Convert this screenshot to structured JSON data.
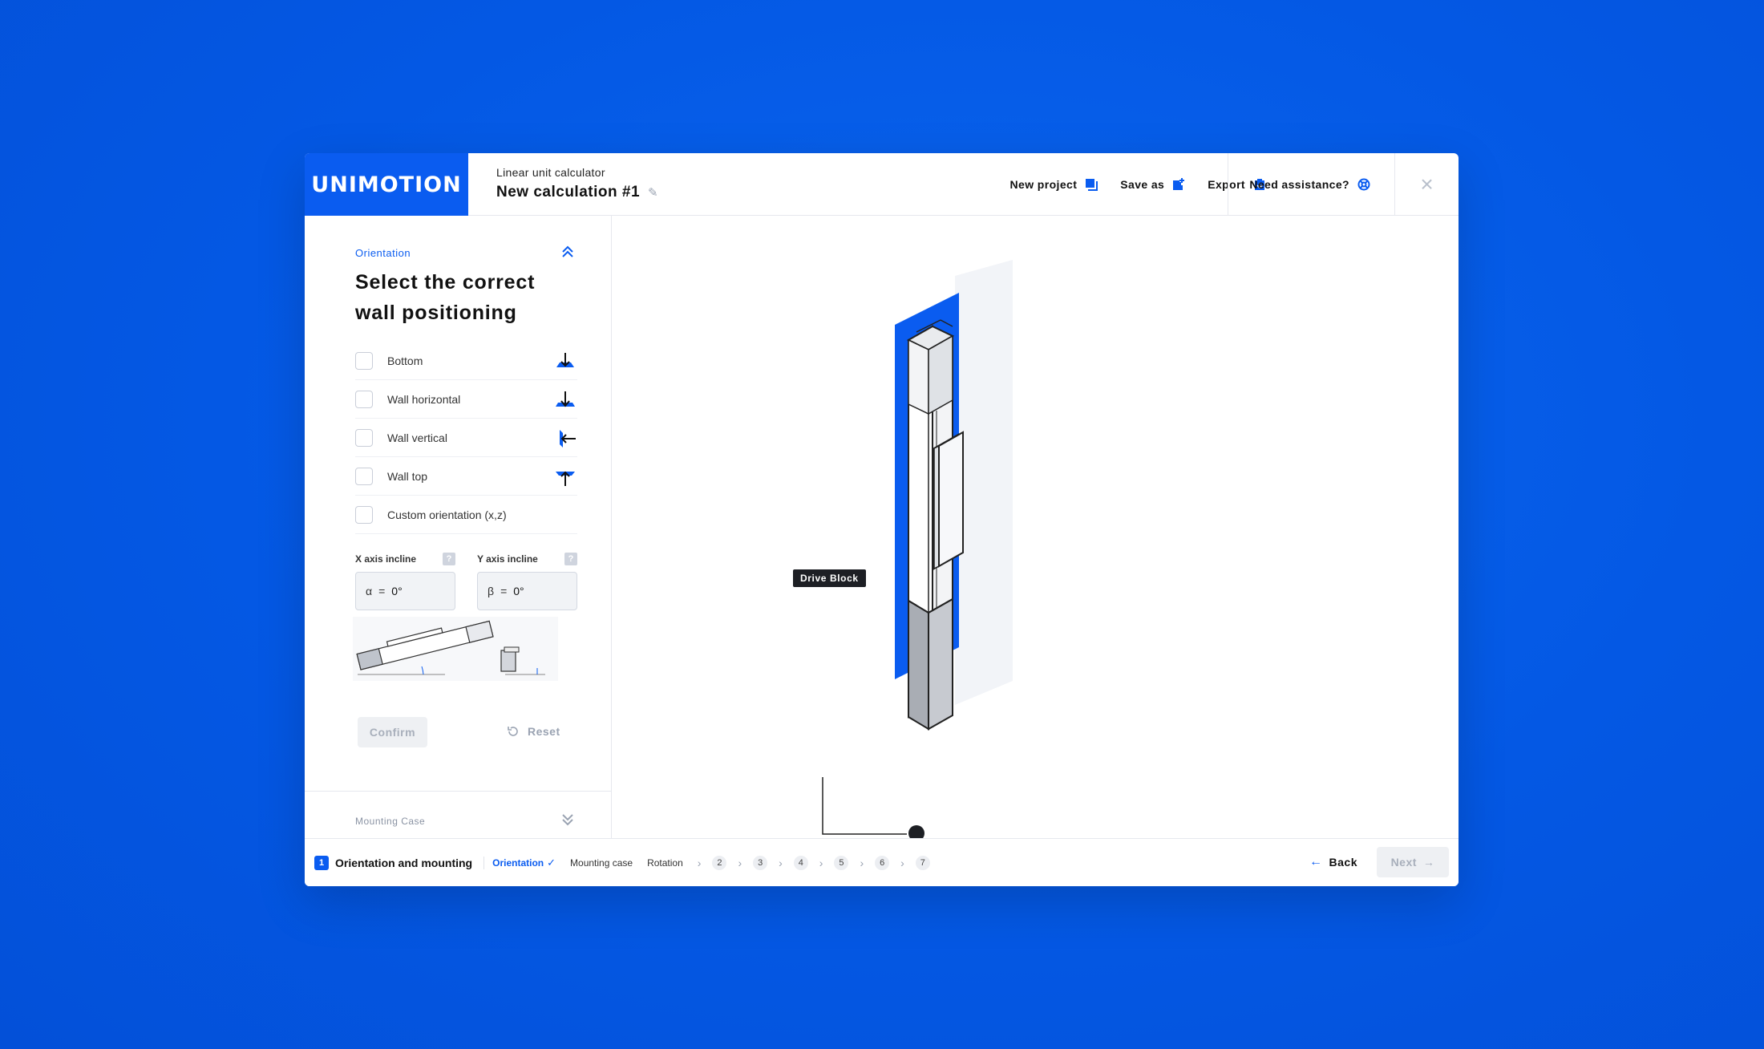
{
  "header": {
    "logo": "UNIMOTION",
    "subtitle": "Linear unit calculator",
    "title": "New calculation #1",
    "actions": {
      "new_project": "New project",
      "save_as": "Save as",
      "export": "Export"
    },
    "assistance": "Need assistance?"
  },
  "sidebar": {
    "section": "Orientation",
    "heading": "Select the correct wall positioning",
    "options": [
      {
        "label": "Bottom",
        "icon": "arrow-down-floor-icon"
      },
      {
        "label": "Wall horizontal",
        "icon": "arrow-down-wall-icon"
      },
      {
        "label": "Wall vertical",
        "icon": "arrow-left-wall-icon"
      },
      {
        "label": "Wall top",
        "icon": "arrow-up-ceiling-icon"
      },
      {
        "label": "Custom orientation (x,z)",
        "icon": ""
      }
    ],
    "x_incline": {
      "label": "X axis incline",
      "symbol": "α",
      "eq": "=",
      "value": "0°",
      "help": "?"
    },
    "y_incline": {
      "label": "Y axis incline",
      "symbol": "β",
      "eq": "=",
      "value": "0°",
      "help": "?"
    },
    "confirm": "Confirm",
    "reset": "Reset",
    "next_section": "Mounting Case"
  },
  "canvas": {
    "tag": "Drive Block"
  },
  "footer": {
    "step_number": "1",
    "step_title": "Orientation and mounting",
    "crumbs": {
      "orientation": "Orientation",
      "mounting": "Mounting case",
      "rotation": "Rotation"
    },
    "steps": [
      "2",
      "3",
      "4",
      "5",
      "6",
      "7"
    ],
    "back": "Back",
    "next": "Next"
  },
  "colors": {
    "accent": "#0a5cf0",
    "background": "#0458e4",
    "disabled": "#a8afbb"
  }
}
